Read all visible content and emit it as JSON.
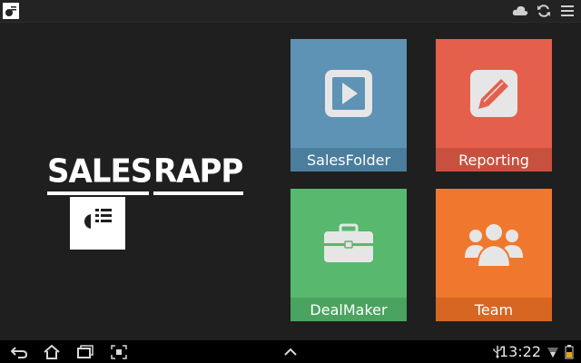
{
  "app": {
    "name_part_1": "SALES",
    "name_part_2": "RAPP"
  },
  "topbar": {
    "icons": [
      "app-logo-icon",
      "cloud-icon",
      "sync-icon",
      "menu-icon"
    ]
  },
  "tiles": [
    {
      "label": "SalesFolder",
      "icon": "play-icon",
      "color": "#5e93b5"
    },
    {
      "label": "Reporting",
      "icon": "pencil-icon",
      "color": "#e45f4c"
    },
    {
      "label": "DealMaker",
      "icon": "briefcase-icon",
      "color": "#58b86e"
    },
    {
      "label": "Team",
      "icon": "people-icon",
      "color": "#f0782e"
    }
  ],
  "navbar": {
    "buttons": [
      "back-icon",
      "home-icon",
      "recent-apps-icon",
      "screenshot-icon",
      "up-icon"
    ],
    "status_icons": [
      "usb-icon",
      "wifi-icon",
      "battery-icon"
    ],
    "time": "13:22"
  }
}
